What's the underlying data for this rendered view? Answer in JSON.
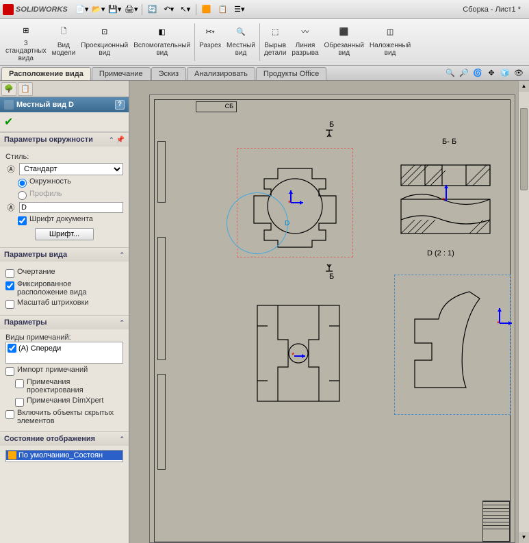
{
  "app": {
    "name": "SOLIDWORKS",
    "doc_title": "Сборка - Лист1 *"
  },
  "qat": {
    "items": [
      "new",
      "open",
      "save",
      "print",
      "rebuild",
      "undo",
      "select",
      "options",
      "macro",
      "settings"
    ]
  },
  "ribbon": {
    "items": [
      {
        "label": "3\nстандартных\nвида"
      },
      {
        "label": "Вид\nмодели"
      },
      {
        "label": "Проекционный\nвид"
      },
      {
        "label": "Вспомогательный\nвид"
      },
      {
        "label": "Разрез"
      },
      {
        "label": "Местный\nвид"
      },
      {
        "label": "Вырыв\nдетали"
      },
      {
        "label": "Линия\nразрыва"
      },
      {
        "label": "Обрезанный\nвид"
      },
      {
        "label": "Наложенный\nвид"
      }
    ]
  },
  "tabs": {
    "items": [
      "Расположение вида",
      "Примечание",
      "Эскиз",
      "Анализировать",
      "Продукты Office"
    ],
    "active": 0
  },
  "panel": {
    "title": "Местный вид D",
    "sec_circle": {
      "title": "Параметры окружности",
      "style_label": "Стиль:",
      "style_value": "Стандарт",
      "opt_circle": "Окружность",
      "opt_profile": "Профиль",
      "name_value": "D",
      "doc_font": "Шрифт документа",
      "font_btn": "Шрифт..."
    },
    "sec_view": {
      "title": "Параметры вида",
      "outline": "Очертание",
      "fixed_pos": "Фиксированное расположение вида",
      "hatch_scale": "Масштаб штриховки"
    },
    "sec_params": {
      "title": "Параметры",
      "annot_types": "Виды примечаний:",
      "front": "(A) Спереди",
      "import": "Импорт примечаний",
      "design": "Примечания проектирования",
      "dimxpert": "Примечания DimXpert",
      "hidden": "Включить объекты скрытых элементов"
    },
    "sec_display": {
      "title": "Состояние отображения",
      "default": "По умолчанию_Состоян"
    }
  },
  "canvas": {
    "section_b": "Б",
    "section_bb": "Б- Б",
    "detail_label": "D  (2 : 1)",
    "detail_d": "D",
    "cb": "СБ"
  }
}
